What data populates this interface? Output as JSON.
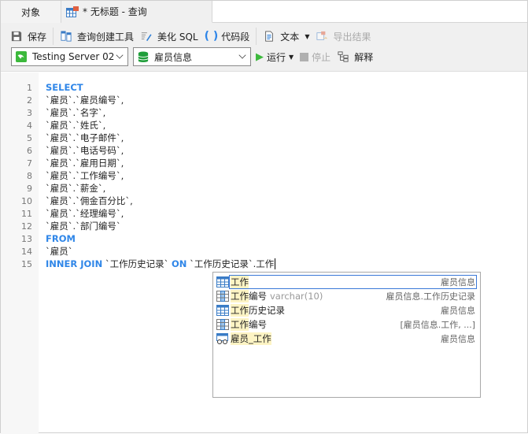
{
  "tabs": [
    {
      "label": "对象"
    },
    {
      "label": "* 无标题 - 查询"
    }
  ],
  "toolbar": {
    "save": "保存",
    "query_builder": "查询创建工具",
    "beautify": "美化 SQL",
    "snippet": "代码段",
    "text": "文本",
    "export": "导出结果",
    "run": "运行",
    "stop": "停止",
    "explain": "解释"
  },
  "connection": {
    "server": "Testing Server 02",
    "database": "雇员信息"
  },
  "colors": {
    "keyword": "#2f86e8",
    "run": "#3cb93c",
    "db": "#1f9e3a",
    "highlight": "#fdf4c4"
  },
  "editor": {
    "lines": [
      {
        "n": "1",
        "kw": "SELECT",
        "text": ""
      },
      {
        "n": "2",
        "kw": "",
        "text": "`雇员`.`雇员编号`,"
      },
      {
        "n": "3",
        "kw": "",
        "text": "`雇员`.`名字`,"
      },
      {
        "n": "4",
        "kw": "",
        "text": "`雇员`.`姓氏`,"
      },
      {
        "n": "5",
        "kw": "",
        "text": "`雇员`.`电子邮件`,"
      },
      {
        "n": "6",
        "kw": "",
        "text": "`雇员`.`电话号码`,"
      },
      {
        "n": "7",
        "kw": "",
        "text": "`雇员`.`雇用日期`,"
      },
      {
        "n": "8",
        "kw": "",
        "text": "`雇员`.`工作编号`,"
      },
      {
        "n": "9",
        "kw": "",
        "text": "`雇员`.`薪金`,"
      },
      {
        "n": "10",
        "kw": "",
        "text": "`雇员`.`佣金百分比`,"
      },
      {
        "n": "11",
        "kw": "",
        "text": "`雇员`.`经理编号`,"
      },
      {
        "n": "12",
        "kw": "",
        "text": "`雇员`.`部门编号`"
      },
      {
        "n": "13",
        "kw": "FROM",
        "text": ""
      },
      {
        "n": "14",
        "kw": "",
        "text": "`雇员`"
      }
    ],
    "line15": {
      "n": "15",
      "kw1": "INNER JOIN",
      "t1": " `工作历史记录` ",
      "kw2": "ON",
      "t2": " `工作历史记录`.工作"
    }
  },
  "autocomplete": [
    {
      "icon": "table-icon",
      "match": "工作",
      "rest": "",
      "type": "",
      "context": "雇员信息"
    },
    {
      "icon": "column-icon",
      "match": "工作",
      "rest": "编号",
      "type": "varchar(10)",
      "context": "雇员信息.工作历史记录"
    },
    {
      "icon": "table-icon",
      "match": "工作",
      "rest": "历史记录",
      "type": "",
      "context": "雇员信息"
    },
    {
      "icon": "column-icon",
      "match": "工作",
      "rest": "编号",
      "type": "",
      "context": "[雇员信息.工作, ...]"
    },
    {
      "icon": "view-icon",
      "match": "雇员_工作",
      "rest": "",
      "type": "",
      "context": "雇员信息"
    }
  ]
}
